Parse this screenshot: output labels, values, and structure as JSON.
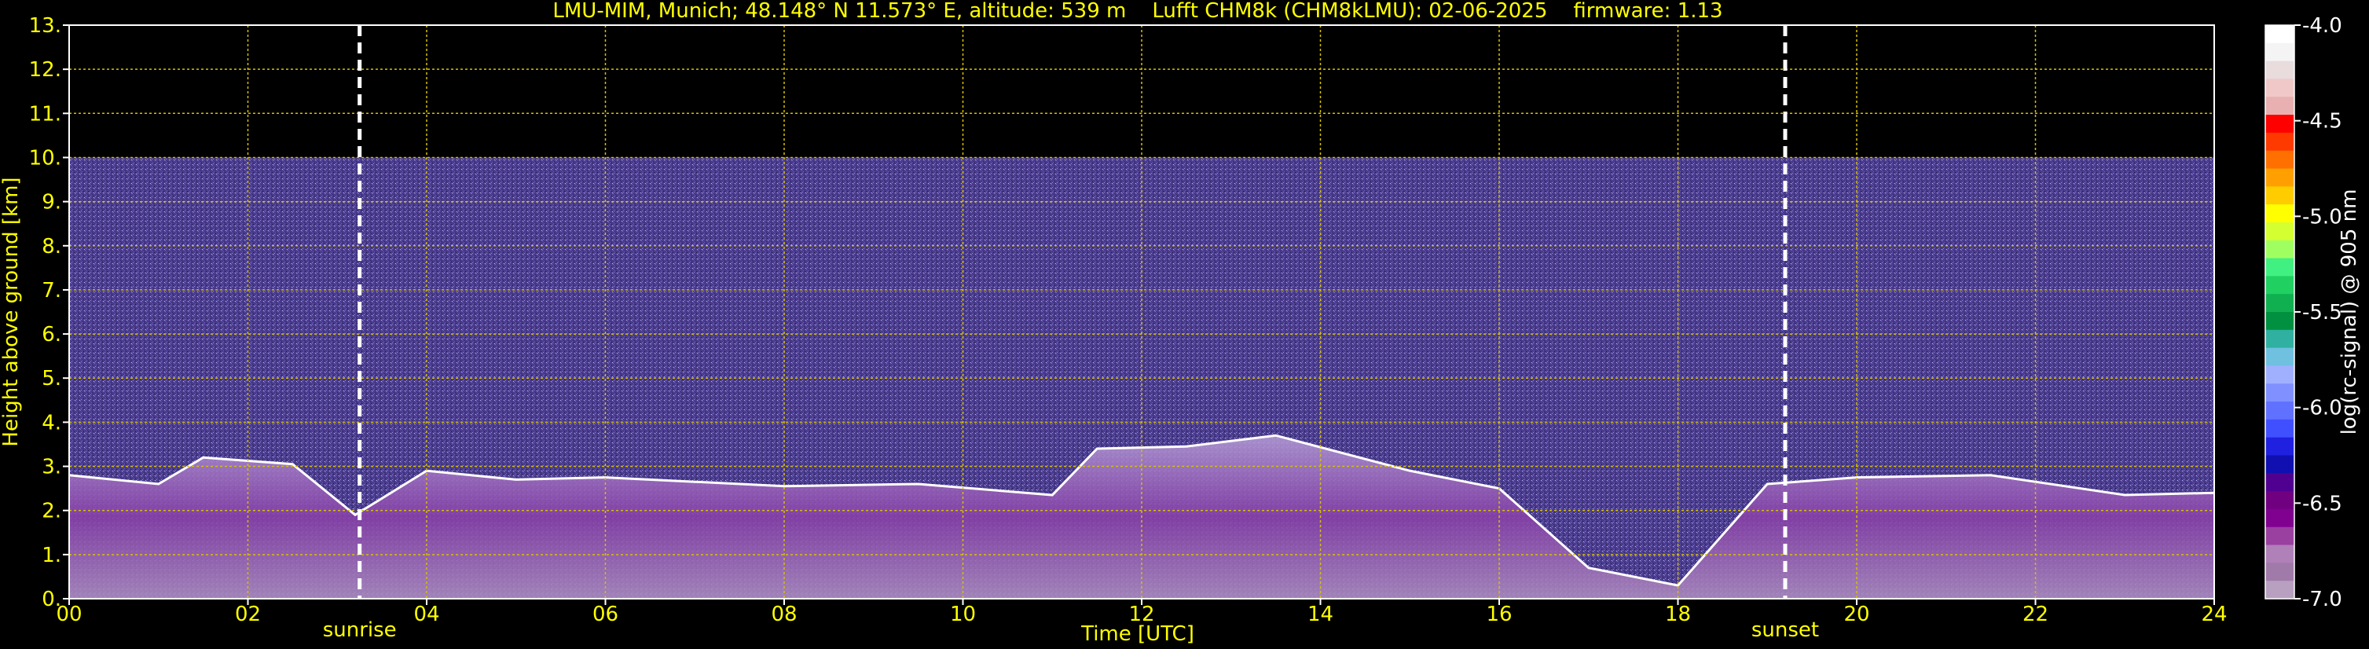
{
  "chart_data": {
    "type": "heatmap",
    "title": "LMU-MIM, Munich; 48.148° N 11.573° E, altitude: 539 m    Lufft CHM8k (CHM8kLMU): 02-06-2025    firmware: 1.13",
    "xlabel": "Time [UTC]",
    "ylabel": "Height above ground [km]",
    "colorbar_label": "log(rc-signal) @ 905 nm",
    "xlim": [
      0,
      24
    ],
    "ylim": [
      0,
      13
    ],
    "x_ticks": [
      "00",
      "02",
      "04",
      "06",
      "08",
      "10",
      "12",
      "14",
      "16",
      "18",
      "20",
      "22",
      "24"
    ],
    "y_ticks": [
      "0.",
      "1.",
      "2.",
      "3.",
      "4.",
      "5.",
      "6.",
      "7.",
      "8.",
      "9.",
      "10.",
      "11.",
      "12.",
      "13."
    ],
    "colorbar_range": [
      -7.0,
      -4.0
    ],
    "colorbar_ticks": [
      "-4.0",
      "-4.5",
      "-5.0",
      "-5.5",
      "-6.0",
      "-6.5",
      "-7.0"
    ],
    "grid": true,
    "data_ceiling_km": 10.0,
    "markers": [
      {
        "label": "sunrise",
        "time": 3.25
      },
      {
        "label": "sunset",
        "time": 19.2
      }
    ],
    "boundary_layer_top_km": [
      {
        "t": 0.0,
        "h": 2.8
      },
      {
        "t": 1.0,
        "h": 2.6
      },
      {
        "t": 1.5,
        "h": 3.2
      },
      {
        "t": 2.5,
        "h": 3.05
      },
      {
        "t": 3.2,
        "h": 1.9
      },
      {
        "t": 4.0,
        "h": 2.9
      },
      {
        "t": 5.0,
        "h": 2.7
      },
      {
        "t": 6.0,
        "h": 2.75
      },
      {
        "t": 7.0,
        "h": 2.65
      },
      {
        "t": 8.0,
        "h": 2.55
      },
      {
        "t": 9.5,
        "h": 2.6
      },
      {
        "t": 11.0,
        "h": 2.35
      },
      {
        "t": 11.5,
        "h": 3.4
      },
      {
        "t": 12.5,
        "h": 3.45
      },
      {
        "t": 13.5,
        "h": 3.7
      },
      {
        "t": 15.0,
        "h": 2.9
      },
      {
        "t": 16.0,
        "h": 2.5
      },
      {
        "t": 17.0,
        "h": 0.7
      },
      {
        "t": 18.0,
        "h": 0.3
      },
      {
        "t": 19.0,
        "h": 2.6
      },
      {
        "t": 20.0,
        "h": 2.75
      },
      {
        "t": 21.5,
        "h": 2.8
      },
      {
        "t": 23.0,
        "h": 2.35
      },
      {
        "t": 24.0,
        "h": 2.4
      }
    ],
    "colors": {
      "background": "#000000",
      "text": "#ffff00",
      "grid": "#d4c000",
      "noise": "#4a3c8c",
      "marker_line": "#ffffff"
    }
  }
}
